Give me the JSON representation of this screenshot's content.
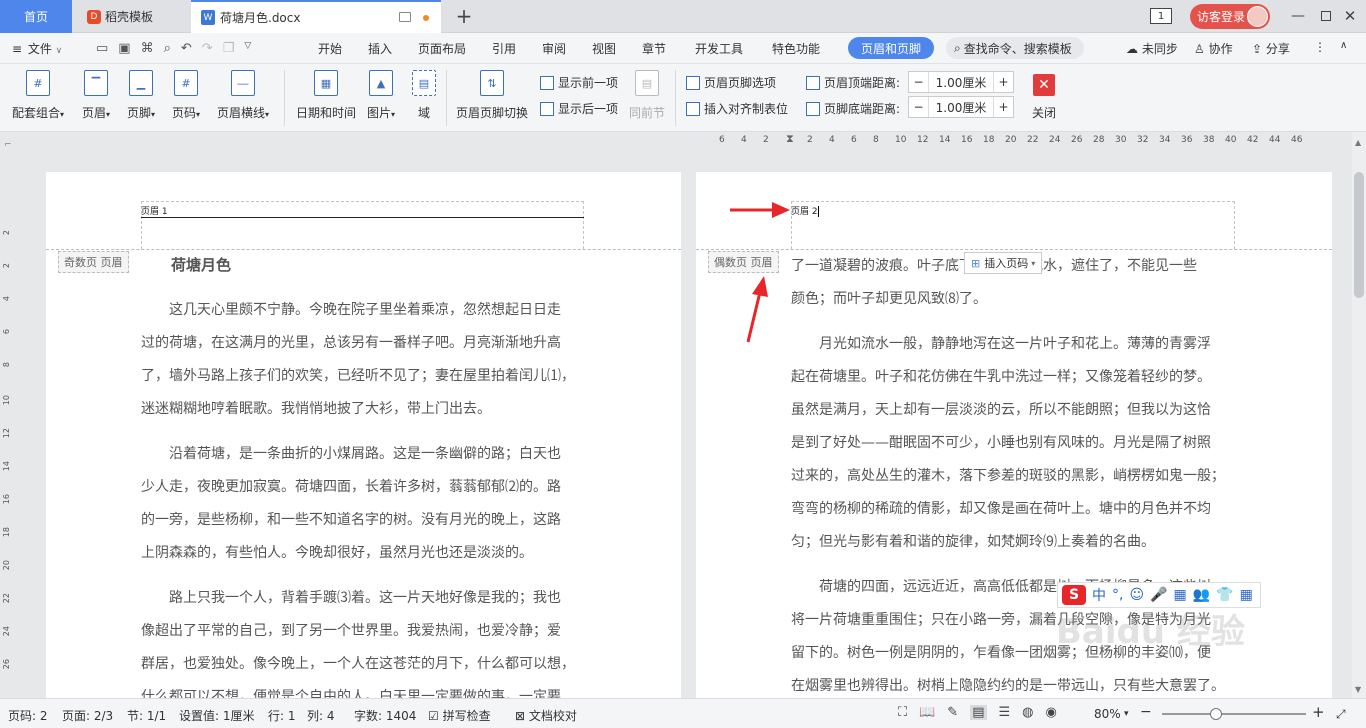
{
  "tabs": {
    "home": "首页",
    "template": "稻壳模板",
    "document": "荷塘月色.docx"
  },
  "window": {
    "page_count_badge": "1",
    "login_label": "访客登录"
  },
  "menu": {
    "file": "文件",
    "items": [
      "开始",
      "插入",
      "页面布局",
      "引用",
      "审阅",
      "视图",
      "章节",
      "开发工具",
      "特色功能"
    ],
    "active": "页眉和页脚",
    "search": "查找命令、搜索模板",
    "unsync": "未同步",
    "collab": "协作",
    "share": "分享"
  },
  "ribbon": {
    "combo": "配套组合",
    "header": "页眉",
    "footer": "页脚",
    "page_num": "页码",
    "header_line": "页眉横线",
    "datetime": "日期和时间",
    "picture": "图片",
    "field": "域",
    "switch": "页眉页脚切换",
    "show_prev": "显示前一项",
    "show_next": "显示后一项",
    "same_prev": "同前节",
    "options": "页眉页脚选项",
    "align_tab": "插入对齐制表位",
    "top_dist_label": "页眉顶端距离:",
    "top_dist_value": "1.00厘米",
    "bottom_dist_label": "页脚底端距离:",
    "bottom_dist_value": "1.00厘米",
    "close": "关闭"
  },
  "ruler": {
    "ticks": [
      "6",
      "4",
      "2",
      "",
      "2",
      "4",
      "6",
      "8",
      "10",
      "12",
      "14",
      "16",
      "18",
      "20",
      "22",
      "24",
      "26",
      "28",
      "30",
      "32",
      "34",
      "36",
      "38",
      "40",
      "42",
      "44",
      "46"
    ],
    "vticks": [
      "2",
      "2",
      "4",
      "6",
      "8",
      "10",
      "12",
      "14",
      "16",
      "18",
      "20",
      "22",
      "24",
      "26"
    ]
  },
  "page1": {
    "header_text": "页眉 1",
    "header_label": "奇数页 页眉",
    "title": "荷塘月色",
    "lines": [
      "　　这几天心里颇不宁静。今晚在院子里坐着乘凉，忽然想起日日走",
      "过的荷塘，在这满月的光里，总该另有一番样子吧。月亮渐渐地升高",
      "了，墙外马路上孩子们的欢笑，已经听不见了；妻在屋里拍着闰儿⑴，",
      "迷迷糊糊地哼着眠歌。我悄悄地披了大衫，带上门出去。",
      "",
      "　　沿着荷塘，是一条曲折的小煤屑路。这是一条幽僻的路；白天也",
      "少人走，夜晚更加寂寞。荷塘四面，长着许多树，蓊蓊郁郁⑵的。路",
      "的一旁，是些杨柳，和一些不知道名字的树。没有月光的晚上，这路",
      "上阴森森的，有些怕人。今晚却很好，虽然月光也还是淡淡的。",
      "",
      "　　路上只我一个人，背着手踱⑶着。这一片天地好像是我的；我也",
      "像超出了平常的自己，到了另一个世界里。我爱热闹，也爱冷静；爱",
      "群居，也爱独处。像今晚上，一个人在这苍茫的月下，什么都可以想，",
      "什么都可以不想，便觉是个自由的人。白天里一定要做的事，一定要"
    ]
  },
  "page2": {
    "header_text": "页眉 2",
    "header_label": "偶数页 页眉",
    "insert_pagenum": "插入页码",
    "lines": [
      "了一道凝碧的波痕。叶子底下是脉脉的流水，遮住了，不能见一些",
      "颜色；而叶子却更见风致⑻了。",
      "",
      "　　月光如流水一般，静静地泻在这一片叶子和花上。薄薄的青雾浮",
      "起在荷塘里。叶子和花仿佛在牛乳中洗过一样；又像笼着轻纱的梦。",
      "虽然是满月，天上却有一层淡淡的云，所以不能朗照；但我以为这恰",
      "是到了好处——酣眠固不可少，小睡也别有风味的。月光是隔了树照",
      "过来的，高处丛生的灌木，落下参差的斑驳的黑影，峭楞楞如鬼一般；",
      "弯弯的杨柳的稀疏的倩影，却又像是画在荷叶上。塘中的月色并不均",
      "匀；但光与影有着和谐的旋律，如梵婀玲⑼上奏着的名曲。",
      "",
      "　　荷塘的四面，远远近近，高高低低都是树，而杨柳最多。这些树",
      "将一片荷塘重重围住；只在小路一旁，漏着几段空隙，像是特为月光",
      "留下的。树色一例是阴阴的，乍看像一团烟雾；但杨柳的丰姿⑽，便",
      "在烟雾里也辨得出。树梢上隐隐约约的是一带远山，只有些大意罢了。"
    ]
  },
  "ime": {
    "items": [
      "中",
      "°,",
      "☺",
      "🎤",
      "▦",
      "👥",
      "👕",
      "▦"
    ]
  },
  "watermark": "Baidu 经验",
  "status": {
    "page": "页码: 2",
    "pages": "页面: 2/3",
    "section": "节: 1/1",
    "setting": "设置值: 1厘米",
    "row": "行: 1",
    "col": "列: 4",
    "words": "字数: 1404",
    "spell": "拼写检查",
    "proof": "文档校对",
    "zoom": "80%"
  },
  "colors": {
    "accent": "#4f86ec",
    "arrow": "#e8262a",
    "close_red": "#e03c3c"
  }
}
